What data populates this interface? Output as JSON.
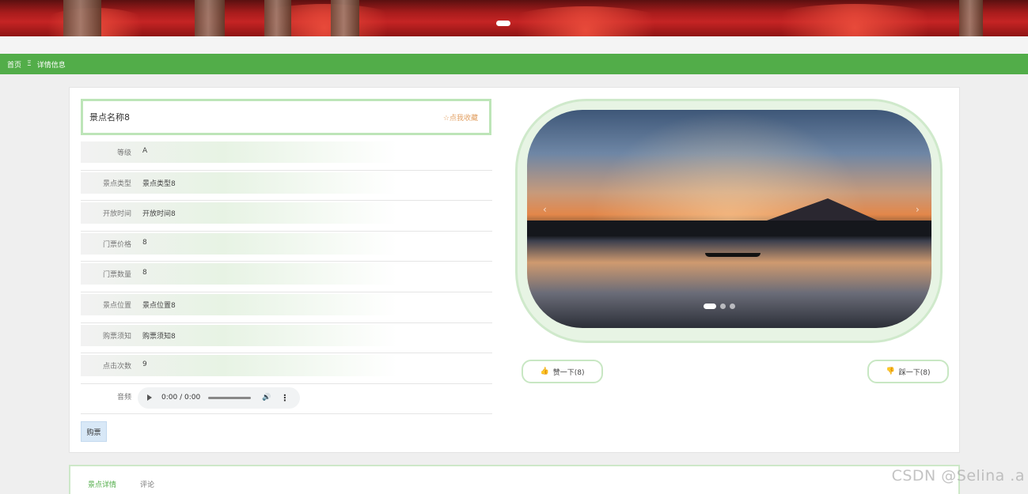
{
  "nav": {
    "home": "首页",
    "separator": "Ξ",
    "current": "详情信息"
  },
  "detail": {
    "title": "景点名称8",
    "favorite_label": "☆点我收藏",
    "rows": [
      {
        "label": "等级",
        "value": "A"
      },
      {
        "label": "景点类型",
        "value": "景点类型8"
      },
      {
        "label": "开放时间",
        "value": "开放时间8"
      },
      {
        "label": "门票价格",
        "value": "8"
      },
      {
        "label": "门票数量",
        "value": "8"
      },
      {
        "label": "景点位置",
        "value": "景点位置8"
      },
      {
        "label": "购票须知",
        "value": "购票须知8"
      },
      {
        "label": "点击次数",
        "value": "9"
      }
    ],
    "audio": {
      "label": "音频",
      "time": "0:00 / 0:00"
    },
    "buy_label": "购票"
  },
  "carousel": {
    "slides": 3,
    "active_index": 0
  },
  "votes": {
    "like_label": "赞一下(8)",
    "dislike_label": "踩一下(8)"
  },
  "tabs": [
    {
      "label": "景点详情",
      "active": true
    },
    {
      "label": "评论",
      "active": false
    }
  ],
  "watermark": "CSDN @Selina .a",
  "colors": {
    "accent": "#52ad49",
    "border_green": "#bde5b8",
    "favorite": "#e2a063"
  },
  "icons": {
    "like": "thumbs-up-icon",
    "dislike": "thumbs-down-icon",
    "play": "play-icon",
    "volume": "volume-icon",
    "more": "more-vertical-icon"
  }
}
